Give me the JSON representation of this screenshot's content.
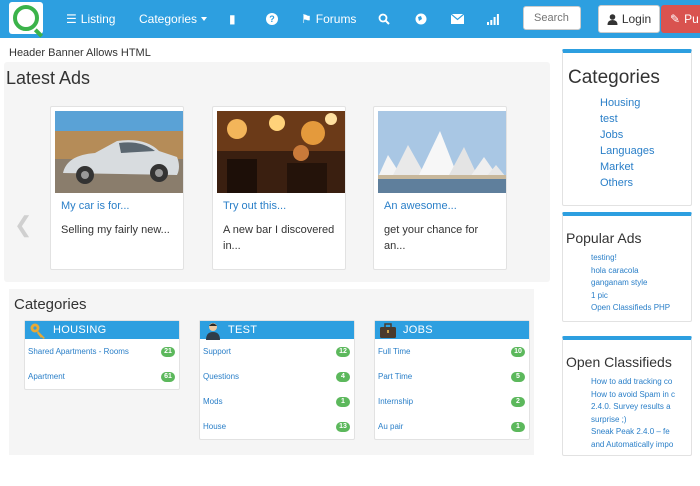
{
  "nav": {
    "listing": "Listing",
    "categories": "Categories",
    "forums": "Forums",
    "search_placeholder": "Search",
    "login": "Login",
    "publish": "Pu",
    "icons": [
      "list-icon",
      "book-icon",
      "question-icon",
      "tag-icon",
      "search-icon",
      "globe-icon",
      "envelope-icon",
      "signal-icon",
      "user-icon",
      "pencil-icon"
    ]
  },
  "banner": "Header Banner Allows HTML",
  "latest": {
    "title": "Latest Ads",
    "ads": [
      {
        "title": "My car is for...",
        "desc": "Selling my fairly new..."
      },
      {
        "title": "Try out this...",
        "desc": "A new bar I discovered in..."
      },
      {
        "title": "An awesome...",
        "desc": "get your chance for an..."
      }
    ]
  },
  "categories": {
    "title": "Categories",
    "groups": [
      {
        "name": "HOUSING",
        "icon": "key-icon",
        "rows": [
          {
            "label": "Shared Apartments - Rooms",
            "count": "21"
          },
          {
            "label": "Apartment",
            "count": "61"
          }
        ]
      },
      {
        "name": "TEST",
        "icon": "person-icon",
        "rows": [
          {
            "label": "Support",
            "count": "12"
          },
          {
            "label": "Questions",
            "count": "4"
          },
          {
            "label": "Mods",
            "count": "1"
          },
          {
            "label": "House",
            "count": "13"
          }
        ]
      },
      {
        "name": "JOBS",
        "icon": "briefcase-icon",
        "rows": [
          {
            "label": "Full Time",
            "count": "10"
          },
          {
            "label": "Part Time",
            "count": "5"
          },
          {
            "label": "Internship",
            "count": "2"
          },
          {
            "label": "Au pair",
            "count": "1"
          }
        ]
      }
    ]
  },
  "sidebar": {
    "categories": {
      "title": "Categories",
      "items": [
        "Housing",
        "test",
        "Jobs",
        "Languages",
        "Market",
        "Others"
      ]
    },
    "popular": {
      "title": "Popular Ads",
      "items": [
        "testing!",
        "hola caracola",
        "ganganam style",
        "1 pic",
        "Open Classifieds PHP"
      ]
    },
    "oc": {
      "title": "Open Classifieds",
      "items": [
        "How to add tracking co",
        "How to avoid Spam in c",
        "2.4.0. Survey results a",
        "surprise ;)",
        "Sneak Peak 2.4.0 – fe",
        "and Automatically impo"
      ]
    }
  },
  "colors": {
    "nav": "#2d9fe0",
    "link": "#2a7fc8",
    "badge": "#5cb85c",
    "publish": "#d9534f"
  }
}
